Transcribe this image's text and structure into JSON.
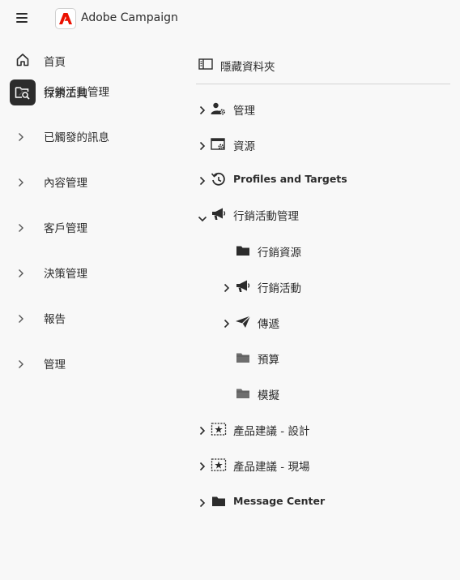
{
  "app": {
    "title": "Adobe Campaign",
    "logo_icon": "adobe-logo-icon",
    "brand_color": "#eb1000"
  },
  "sidebar": {
    "home": {
      "label": "首頁",
      "icon": "home-icon"
    },
    "explorer": {
      "label": "探索工具",
      "icon": "folder-search-icon",
      "active": true
    },
    "items": [
      {
        "label": "行銷活動管理"
      },
      {
        "label": "已觸發的訊息"
      },
      {
        "label": "內容管理"
      },
      {
        "label": "客戶管理"
      },
      {
        "label": "決策管理"
      },
      {
        "label": "報告"
      },
      {
        "label": "管理"
      }
    ]
  },
  "explorer_panel": {
    "hide_folders_label": "隱藏資料夾",
    "tree": [
      {
        "label": "管理",
        "icon": "user-gear-icon",
        "expand": "collapsed"
      },
      {
        "label": "資源",
        "icon": "window-gear-icon",
        "expand": "collapsed"
      },
      {
        "label": "Profiles and Targets",
        "icon": "history-icon",
        "expand": "collapsed"
      },
      {
        "label": "行銷活動管理",
        "icon": "megaphone-icon",
        "expand": "expanded"
      },
      {
        "label": "行銷資源",
        "icon": "folder-icon",
        "expand": "none"
      },
      {
        "label": "行銷活動",
        "icon": "megaphone-icon",
        "expand": "collapsed"
      },
      {
        "label": "傳遞",
        "icon": "paper-plane-icon",
        "expand": "collapsed"
      },
      {
        "label": "預算",
        "icon": "folder-gray-icon",
        "expand": "none"
      },
      {
        "label": "模擬",
        "icon": "folder-gray-icon",
        "expand": "none"
      },
      {
        "label": "產品建議 - 設計",
        "icon": "star-box-icon",
        "expand": "collapsed"
      },
      {
        "label": "產品建議 - 現場",
        "icon": "star-box-icon",
        "expand": "collapsed"
      },
      {
        "label": "Message Center",
        "icon": "folder-icon",
        "expand": "collapsed"
      }
    ]
  }
}
